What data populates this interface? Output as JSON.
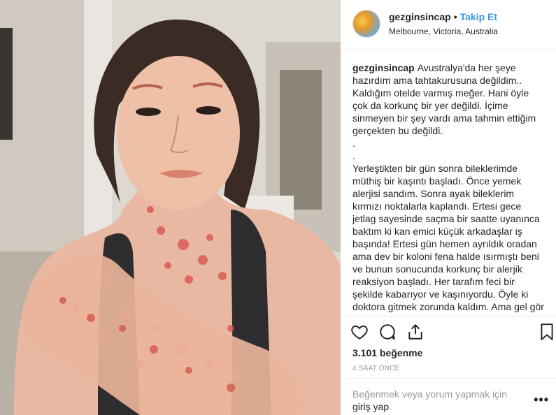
{
  "header": {
    "username": "gezginsincap",
    "separator": "•",
    "follow_label": "Takip Et",
    "location": "Melbourne, Victoria, Australia"
  },
  "caption": {
    "username": "gezginsincap",
    "text": "Avustralya'da her şeye hazırdım ama tahtakurusuna değildim.. Kaldığım otelde varmış meğer. Hani öyle çok da korkunç bir yer değildi. İçime sinmeyen bir şey vardı ama tahmin ettiğim gerçekten bu değildi.\n.\n.\nYerleştikten bir gün sonra bileklerimde müthiş bir kaşıntı başladı. Önce yemek alerjisi sandım. Sonra ayak bileklerim kırmızı noktalarla kaplandı. Ertesi gece jetlag sayesinde saçma bir saatte uyanınca baktım ki kan emici küçük arkadaşlar iş başında! Ertesi gün hemen ayrıldık oradan ama dev bir koloni fena halde ısırmıştı beni ve bunun sonucunda korkunç bir alerjik reaksiyon başladı. Her tarafım feci bir şekilde kabarıyor ve kaşınıyordu. Öyle ki doktora gitmek zorunda kaldım. Ama gel gör ki"
  },
  "actions": {
    "icons": [
      "heart-icon",
      "comment-icon",
      "share-icon",
      "bookmark-icon"
    ]
  },
  "likes": "3.101 beğenme",
  "time": "4 SAAT ÖNCE",
  "footer": {
    "login_prefix": "Beğenmek veya yorum yapmak için ",
    "login_link": "giriş yap",
    "login_suffix": ".",
    "more_label": "•••"
  },
  "colors": {
    "link_blue": "#3897f0",
    "text": "#262626",
    "muted": "#999999",
    "border": "#efefef"
  }
}
